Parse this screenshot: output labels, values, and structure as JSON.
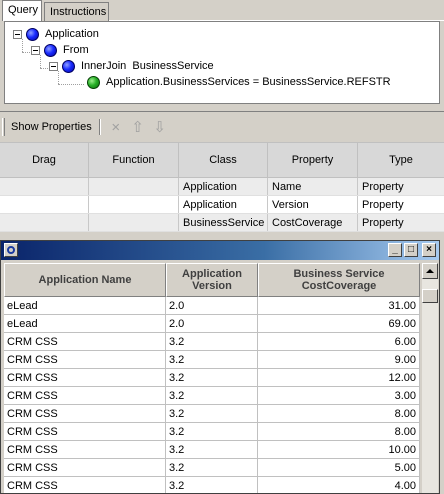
{
  "tabs": [
    {
      "label": "Query",
      "active": true
    },
    {
      "label": "Instructions",
      "active": false
    }
  ],
  "tree": {
    "nodes": [
      {
        "label": "Application",
        "icon": "blue-ball-icon",
        "expandable": true
      },
      {
        "label": "From",
        "icon": "blue-ball-icon",
        "expandable": true
      },
      {
        "label": "InnerJoin  BusinessService",
        "icon": "blue-ball-icon",
        "expandable": true
      },
      {
        "label": "Application.BusinessServices = BusinessService.REFSTR",
        "icon": "green-ball-icon",
        "expandable": false
      }
    ]
  },
  "toolbar": {
    "show_properties_label": "Show Properties",
    "delete_icon": "×",
    "up_icon": "⇧",
    "down_icon": "⇩"
  },
  "properties": {
    "headers": [
      "Drag",
      "Function",
      "Class",
      "Property",
      "Type"
    ],
    "rows": [
      [
        "",
        "",
        "Application",
        "Name",
        "Property"
      ],
      [
        "",
        "",
        "Application",
        "Version",
        "Property"
      ],
      [
        "",
        "",
        "BusinessService",
        "CostCoverage",
        "Property"
      ]
    ]
  },
  "results_window": {
    "buttons": {
      "minimize": "_",
      "maximize": "□",
      "close": "×"
    },
    "headers": [
      "Application Name",
      "Application\nVersion",
      "Business Service\nCostCoverage"
    ],
    "rows": [
      [
        "eLead",
        "2.0",
        "31.00"
      ],
      [
        "eLead",
        "2.0",
        "69.00"
      ],
      [
        "CRM CSS",
        "3.2",
        "6.00"
      ],
      [
        "CRM CSS",
        "3.2",
        "9.00"
      ],
      [
        "CRM CSS",
        "3.2",
        "12.00"
      ],
      [
        "CRM CSS",
        "3.2",
        "3.00"
      ],
      [
        "CRM CSS",
        "3.2",
        "8.00"
      ],
      [
        "CRM CSS",
        "3.2",
        "8.00"
      ],
      [
        "CRM CSS",
        "3.2",
        "10.00"
      ],
      [
        "CRM CSS",
        "3.2",
        "5.00"
      ],
      [
        "CRM CSS",
        "3.2",
        "4.00"
      ]
    ]
  },
  "colors": {
    "titlebar_start": "#0a246a",
    "titlebar_end": "#a6caf0",
    "node_blue": "#1a2cff",
    "node_green": "#28b028"
  }
}
